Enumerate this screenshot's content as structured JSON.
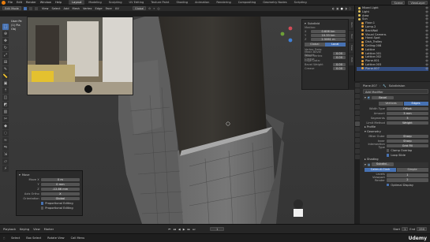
{
  "menu": [
    "File",
    "Edit",
    "Render",
    "Window",
    "Help"
  ],
  "workspaces": [
    "Layout",
    "Modeling",
    "Sculpting",
    "UV Editing",
    "Texture Paint",
    "Shading",
    "Animation",
    "Rendering",
    "Compositing",
    "Geometry Nodes",
    "Scripting"
  ],
  "active_workspace": "Layout",
  "top_right": {
    "scene": "Scene",
    "view_layer": "ViewLayer"
  },
  "header": {
    "mode": "Edit Mode",
    "menus": [
      "View",
      "Select",
      "Add",
      "Mesh",
      "Vertex",
      "Edge",
      "Face",
      "UV"
    ],
    "transform": "Global",
    "options": "Options"
  },
  "viewport_info": {
    "line1": "User Pe",
    "line2": "(1) Pla",
    "line3": "Obj"
  },
  "npanel": {
    "title": "Subdivid",
    "median": "Median:",
    "x": {
      "label": "X",
      "value": "0.606 km"
    },
    "y": {
      "label": "Y",
      "value": "10.33 km"
    },
    "z": {
      "label": "Z",
      "value": "2.5061 m"
    },
    "global": "Global",
    "local": "Local",
    "vertex_data": "Vertex Data:",
    "mean_bevel": {
      "label": "Mean Bevel Weight",
      "value": "0.00"
    },
    "vertex_crease": {
      "label": "Mean Vertex Crease",
      "value": "0.00"
    },
    "edge_data": "Edge Data:",
    "bevel_weight": {
      "label": "Bevel Weight",
      "value": "0.00"
    },
    "crease": {
      "label": "Crease",
      "value": "0.00"
    }
  },
  "ntabs": [
    "Item",
    "Tool",
    "View",
    "Edit"
  ],
  "redo": {
    "title": "Move",
    "move_x": {
      "label": "Move X",
      "value": "0 m"
    },
    "move_y": {
      "label": "Y",
      "value": "0 mm"
    },
    "move_z": {
      "label": "Z",
      "value": "-12.86 mm"
    },
    "axis_ortho": {
      "label": "Axis Ortho",
      "value": "X"
    },
    "orientation": {
      "label": "Orientation",
      "value": "Global"
    },
    "proportional": "Proportional Editing",
    "snap": "Proportional Editing"
  },
  "outliner": {
    "items": [
      "Mixed Light",
      "Light",
      "Area",
      "Sun",
      "Floor.1",
      "Lamp.2",
      "BackWall",
      "Visual Camera.",
      "Hand.Spot",
      "Dish_Trolley",
      "Ceiling.008",
      "Lattice",
      "Lattice.001",
      "Lattice.002",
      "Plane.001",
      "Lattice.003",
      "Plane.007"
    ]
  },
  "props": {
    "object": "Plane.007",
    "modifier_icon": "Subdivision",
    "add_modifier": "Add Modifier",
    "bevel_name": "Bevel",
    "vertices": "Vertices",
    "edges": "Edges",
    "width_type": {
      "label": "Width Type",
      "value": "Offset"
    },
    "amount": {
      "label": "Amount",
      "value": "3 mm"
    },
    "segments": {
      "label": "Segments",
      "value": "3"
    },
    "limit": {
      "label": "Limit Method",
      "value": "Weight"
    },
    "profile": "Profile",
    "geometry": "Geometry",
    "miter_outer": {
      "label": "Miter Outer",
      "value": "Sharp"
    },
    "inner": {
      "label": "Inner",
      "value": "Sharp"
    },
    "intersection": {
      "label": "Intersection Type",
      "value": "Grid Fill"
    },
    "clamp": "Clamp Overlap",
    "loop_slide": "Loop Slide",
    "shading": "Shading",
    "subdiv_name": "Subdivi...",
    "catmull": "Catmull-Clark",
    "simple": "Simple",
    "levels": {
      "label": "Levels Viewport",
      "value": "1"
    },
    "render": {
      "label": "Render",
      "value": "2"
    },
    "optimal": "Optimal Display"
  },
  "timeline": {
    "playback": "Playback",
    "keying": "Keying",
    "view": "View",
    "marker": "Marker",
    "frame": "1",
    "start_label": "Start",
    "start": "1",
    "end_label": "End",
    "end": "250"
  },
  "status": {
    "select": "Select",
    "box_select": "Box Select",
    "rotate": "Rotate View",
    "menu": "Call Menu",
    "brand": "Udemy"
  },
  "colors": {
    "accent": "#4772b3",
    "active_obj": "#e9a23b"
  }
}
